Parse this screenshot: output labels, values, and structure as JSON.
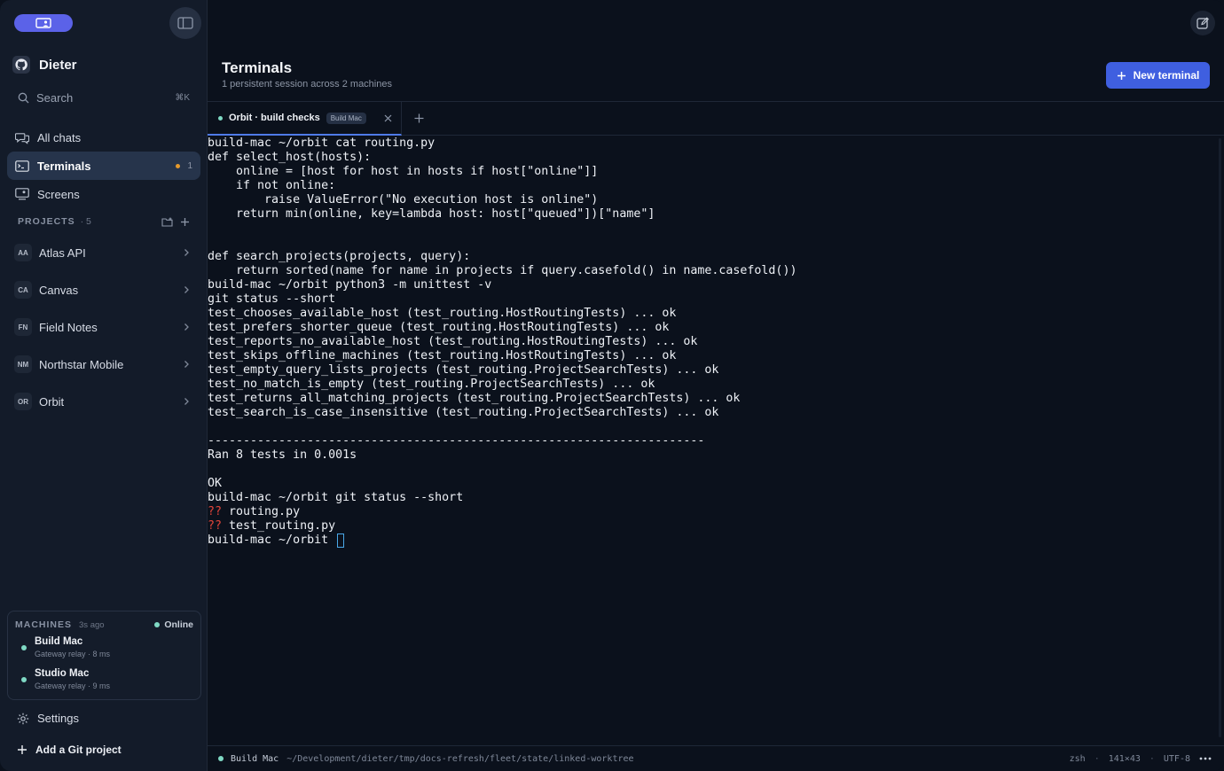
{
  "sidebar": {
    "user_name": "Dieter",
    "search_label": "Search",
    "search_shortcut": "⌘K",
    "nav": {
      "all_chats": "All chats",
      "terminals": "Terminals",
      "terminals_count": "1",
      "screens": "Screens"
    },
    "projects_heading": "PROJECTS",
    "projects_count": "· 5",
    "projects": [
      {
        "abbr": "AA",
        "name": "Atlas API"
      },
      {
        "abbr": "CA",
        "name": "Canvas"
      },
      {
        "abbr": "FN",
        "name": "Field Notes"
      },
      {
        "abbr": "NM",
        "name": "Northstar Mobile"
      },
      {
        "abbr": "OR",
        "name": "Orbit"
      }
    ],
    "machines": {
      "heading": "MACHINES",
      "updated": "3s ago",
      "status": "Online",
      "list": [
        {
          "name": "Build Mac",
          "meta": "Gateway relay · 8 ms"
        },
        {
          "name": "Studio Mac",
          "meta": "Gateway relay · 9 ms"
        }
      ]
    },
    "settings_label": "Settings",
    "add_git_label": "Add a Git project"
  },
  "main": {
    "title": "Terminals",
    "subtitle": "1 persistent session across 2 machines",
    "new_terminal_label": "New terminal",
    "tab": {
      "label": "Orbit · build checks",
      "chip": "Build Mac"
    },
    "terminal_lines": [
      "build-mac ~/orbit cat routing.py",
      "def select_host(hosts):",
      "    online = [host for host in hosts if host[\"online\"]]",
      "    if not online:",
      "        raise ValueError(\"No execution host is online\")",
      "    return min(online, key=lambda host: host[\"queued\"])[\"name\"]",
      "",
      "",
      "def search_projects(projects, query):",
      "    return sorted(name for name in projects if query.casefold() in name.casefold())",
      "build-mac ~/orbit python3 -m unittest -v",
      "git status --short",
      "test_chooses_available_host (test_routing.HostRoutingTests) ... ok",
      "test_prefers_shorter_queue (test_routing.HostRoutingTests) ... ok",
      "test_reports_no_available_host (test_routing.HostRoutingTests) ... ok",
      "test_skips_offline_machines (test_routing.HostRoutingTests) ... ok",
      "test_empty_query_lists_projects (test_routing.ProjectSearchTests) ... ok",
      "test_no_match_is_empty (test_routing.ProjectSearchTests) ... ok",
      "test_returns_all_matching_projects (test_routing.ProjectSearchTests) ... ok",
      "test_search_is_case_insensitive (test_routing.ProjectSearchTests) ... ok",
      "",
      "----------------------------------------------------------------------",
      "Ran 8 tests in 0.001s",
      "",
      "OK",
      "build-mac ~/orbit git status --short"
    ],
    "untracked": [
      {
        "mark": "??",
        "file": "routing.py"
      },
      {
        "mark": "??",
        "file": "test_routing.py"
      }
    ],
    "prompt": "build-mac ~/orbit ",
    "status": {
      "host": "Build Mac",
      "path": "~/Development/dieter/tmp/docs-refresh/fleet/state/linked-worktree",
      "shell": "zsh",
      "size": "141×43",
      "encoding": "UTF-8",
      "separator": "·"
    }
  }
}
